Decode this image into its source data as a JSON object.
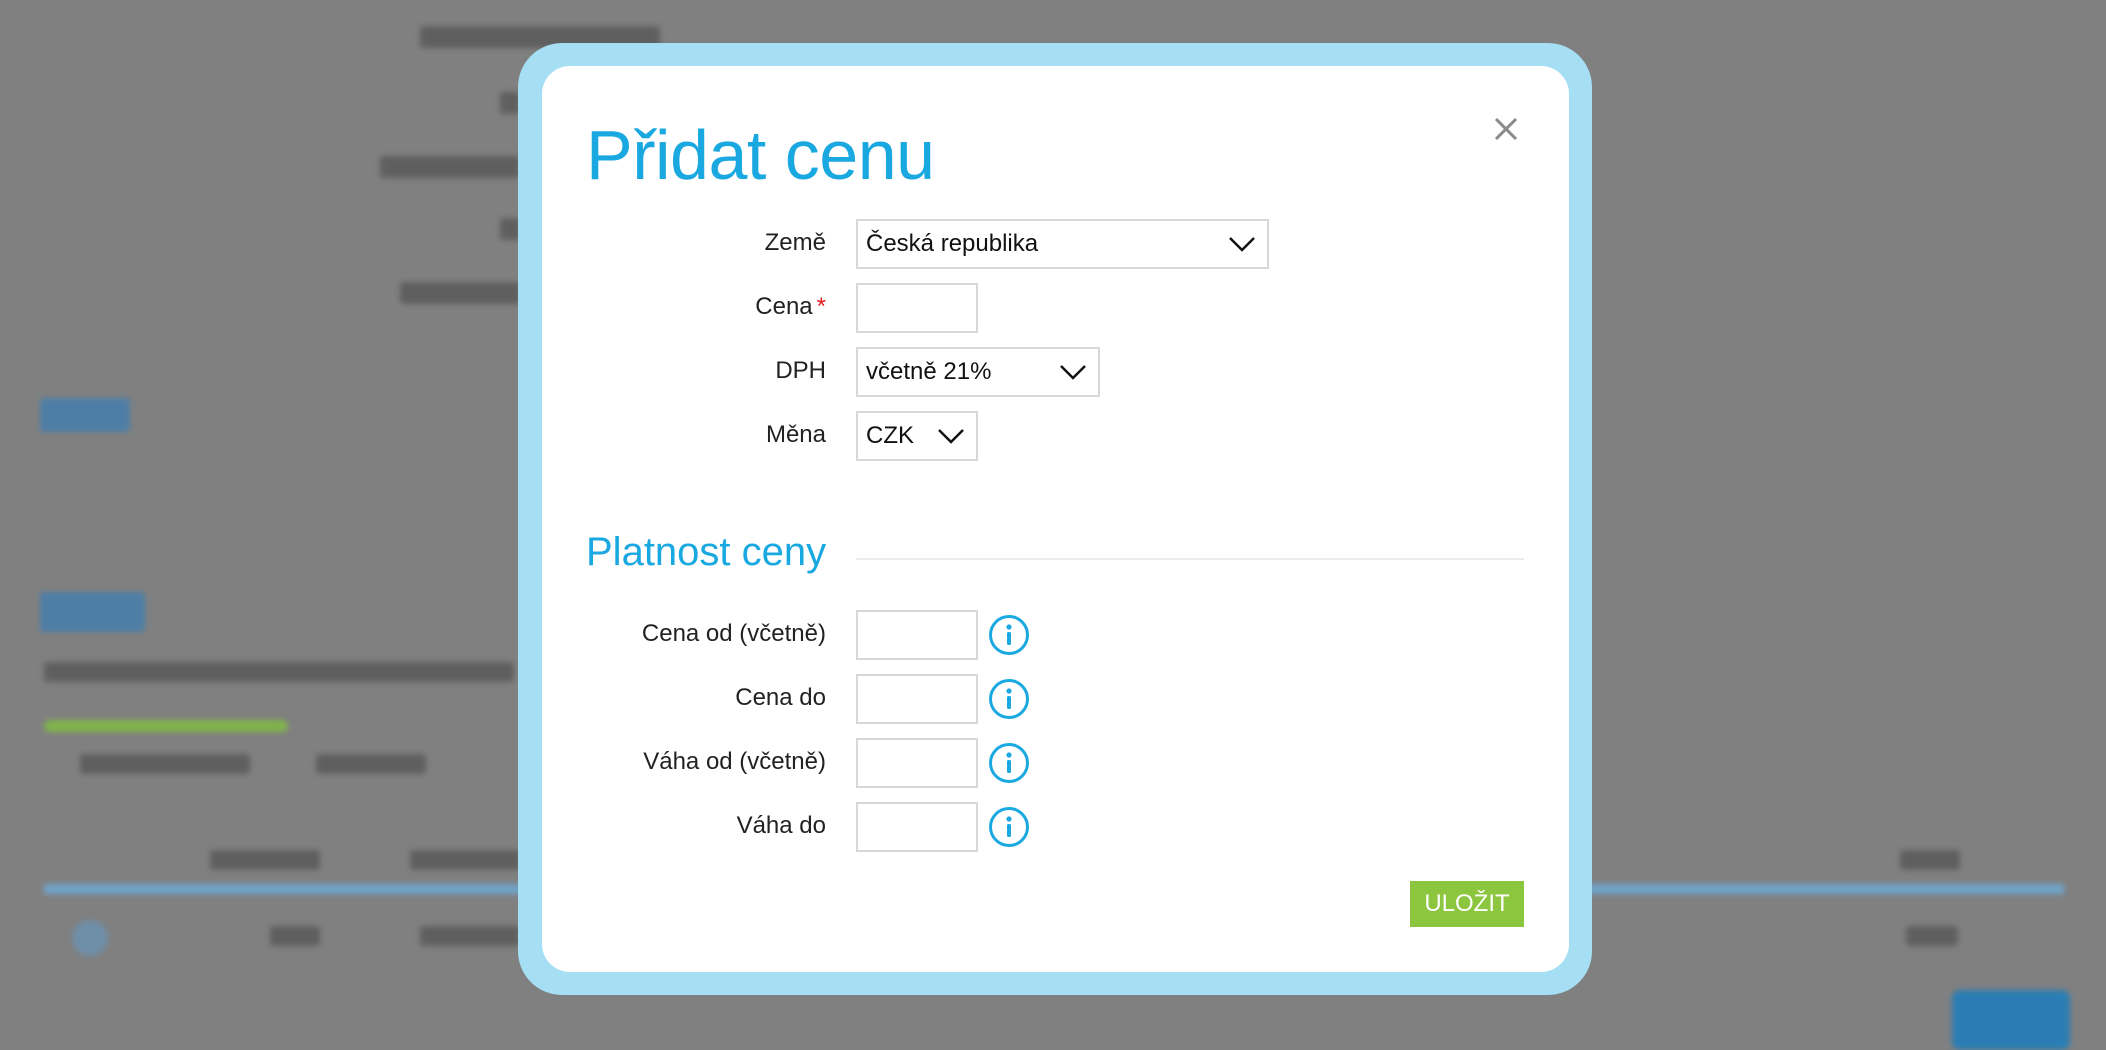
{
  "dialog": {
    "title": "Přidat cenu",
    "close_icon": "close-icon",
    "fields": {
      "country": {
        "label": "Země",
        "value": "Česká republika"
      },
      "price": {
        "label": "Cena",
        "required_mark": "*",
        "value": ""
      },
      "vat": {
        "label": "DPH",
        "value": "včetně 21%"
      },
      "currency": {
        "label": "Měna",
        "value": "CZK"
      }
    },
    "validity": {
      "title": "Platnost ceny",
      "price_from": {
        "label": "Cena od (včetně)",
        "value": "",
        "icon": "info-icon"
      },
      "price_to": {
        "label": "Cena do",
        "value": "",
        "icon": "info-icon"
      },
      "weight_from": {
        "label": "Váha od (včetně)",
        "value": "",
        "icon": "info-icon"
      },
      "weight_to": {
        "label": "Váha do",
        "value": "",
        "icon": "info-icon"
      }
    },
    "save_label": "ULOŽIT"
  },
  "colors": {
    "accent": "#1aa8e0",
    "save": "#8cc63f",
    "frame": "#a6def4",
    "overlay": "#808080",
    "required": "#e11b1b"
  }
}
